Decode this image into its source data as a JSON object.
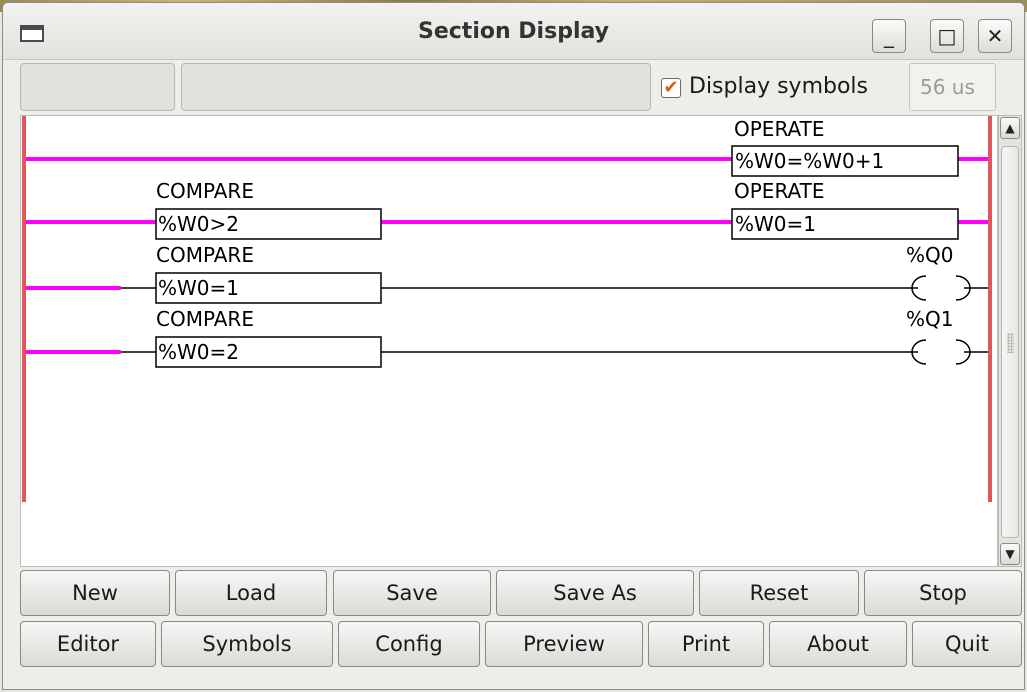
{
  "window": {
    "title": "Section Display"
  },
  "window_controls": {
    "minimize": "_",
    "maximize": "□",
    "close": "✕"
  },
  "toolbar": {
    "field1_value": "",
    "field2_value": "",
    "display_symbols_label": "Display symbols",
    "display_symbols_checked": true,
    "cycle_time": "56 us"
  },
  "ladder": {
    "rail_color": "#e0565b",
    "active_color": "#ff00ff",
    "inactive_color": "#000000",
    "rungs": [
      {
        "left_label": "",
        "left_expr": "",
        "right_label": "OPERATE",
        "right_expr": "%W0=%W0+1"
      },
      {
        "left_label": "COMPARE",
        "left_expr": "%W0>2",
        "right_label": "OPERATE",
        "right_expr": "%W0=1"
      },
      {
        "left_label": "COMPARE",
        "left_expr": "%W0=1",
        "right_label": "%Q0",
        "right_expr": ""
      },
      {
        "left_label": "COMPARE",
        "left_expr": "%W0=2",
        "right_label": "%Q1",
        "right_expr": ""
      }
    ]
  },
  "buttons_row1": [
    "New",
    "Load",
    "Save",
    "Save As",
    "Reset",
    "Stop"
  ],
  "buttons_row2": [
    "Editor",
    "Symbols",
    "Config",
    "Preview",
    "Print",
    "About",
    "Quit"
  ],
  "icons": {
    "window": "window-icon",
    "checkbox": "checkmark-icon",
    "scroll_up": "arrow-up-icon",
    "scroll_down": "arrow-down-icon"
  }
}
